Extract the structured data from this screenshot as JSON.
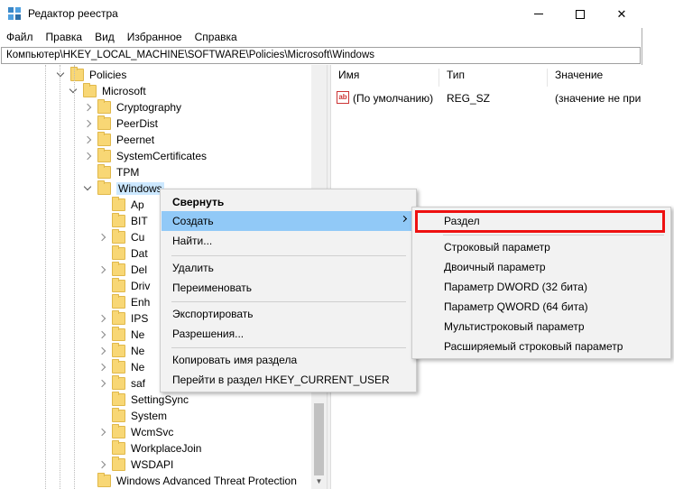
{
  "window": {
    "title": "Редактор реестра",
    "controls": {
      "minimize": "—",
      "close": "✕"
    }
  },
  "menu": [
    "Файл",
    "Правка",
    "Вид",
    "Избранное",
    "Справка"
  ],
  "address": "Компьютер\\HKEY_LOCAL_MACHINE\\SOFTWARE\\Policies\\Microsoft\\Windows",
  "tree": {
    "items": [
      {
        "label": "Policies",
        "level": 0,
        "expand": "down"
      },
      {
        "label": "Microsoft",
        "level": 1,
        "expand": "down"
      },
      {
        "label": "Cryptography",
        "level": 2,
        "expand": "right"
      },
      {
        "label": "PeerDist",
        "level": 2,
        "expand": "right"
      },
      {
        "label": "Peernet",
        "level": 2,
        "expand": "right"
      },
      {
        "label": "SystemCertificates",
        "level": 2,
        "expand": "right"
      },
      {
        "label": "TPM",
        "level": 2,
        "expand": "none"
      },
      {
        "label": "Windows",
        "level": 2,
        "expand": "down",
        "selected": true
      },
      {
        "label": "Ap",
        "level": 3,
        "expand": "none"
      },
      {
        "label": "BIT",
        "level": 3,
        "expand": "none"
      },
      {
        "label": "Cu",
        "level": 3,
        "expand": "right"
      },
      {
        "label": "Dat",
        "level": 3,
        "expand": "none"
      },
      {
        "label": "Del",
        "level": 3,
        "expand": "right"
      },
      {
        "label": "Driv",
        "level": 3,
        "expand": "none"
      },
      {
        "label": "Enh",
        "level": 3,
        "expand": "none"
      },
      {
        "label": "IPS",
        "level": 3,
        "expand": "right"
      },
      {
        "label": "Ne",
        "level": 3,
        "expand": "right"
      },
      {
        "label": "Ne",
        "level": 3,
        "expand": "right"
      },
      {
        "label": "Ne",
        "level": 3,
        "expand": "right"
      },
      {
        "label": "saf",
        "level": 3,
        "expand": "right"
      },
      {
        "label": "SettingSync",
        "level": 3,
        "expand": "none"
      },
      {
        "label": "System",
        "level": 3,
        "expand": "none"
      },
      {
        "label": "WcmSvc",
        "level": 3,
        "expand": "right"
      },
      {
        "label": "WorkplaceJoin",
        "level": 3,
        "expand": "none"
      },
      {
        "label": "WSDAPI",
        "level": 3,
        "expand": "right"
      },
      {
        "label": "Windows Advanced Threat Protection",
        "level": 2,
        "expand": "none"
      }
    ]
  },
  "list": {
    "columns": [
      "Имя",
      "Тип",
      "Значение"
    ],
    "rows": [
      {
        "icon": "ab",
        "name": "(По умолчанию)",
        "type": "REG_SZ",
        "value": "(значение не при"
      }
    ]
  },
  "context_menu": {
    "collapse": "Свернуть",
    "create": "Создать",
    "find": "Найти...",
    "delete": "Удалить",
    "rename": "Переименовать",
    "export": "Экспортировать",
    "permissions": "Разрешения...",
    "copy_key_name": "Копировать имя раздела",
    "goto_hkcu": "Перейти в раздел HKEY_CURRENT_USER"
  },
  "submenu": {
    "key": "Раздел",
    "string": "Строковый параметр",
    "binary": "Двоичный параметр",
    "dword": "Параметр DWORD (32 бита)",
    "qword": "Параметр QWORD (64 бита)",
    "multistring": "Мультистроковый параметр",
    "expandstring": "Расширяемый строковый параметр"
  },
  "colors": {
    "highlight": "#91c9f7",
    "selection": "#cce8ff",
    "annotation": "#e11111"
  }
}
